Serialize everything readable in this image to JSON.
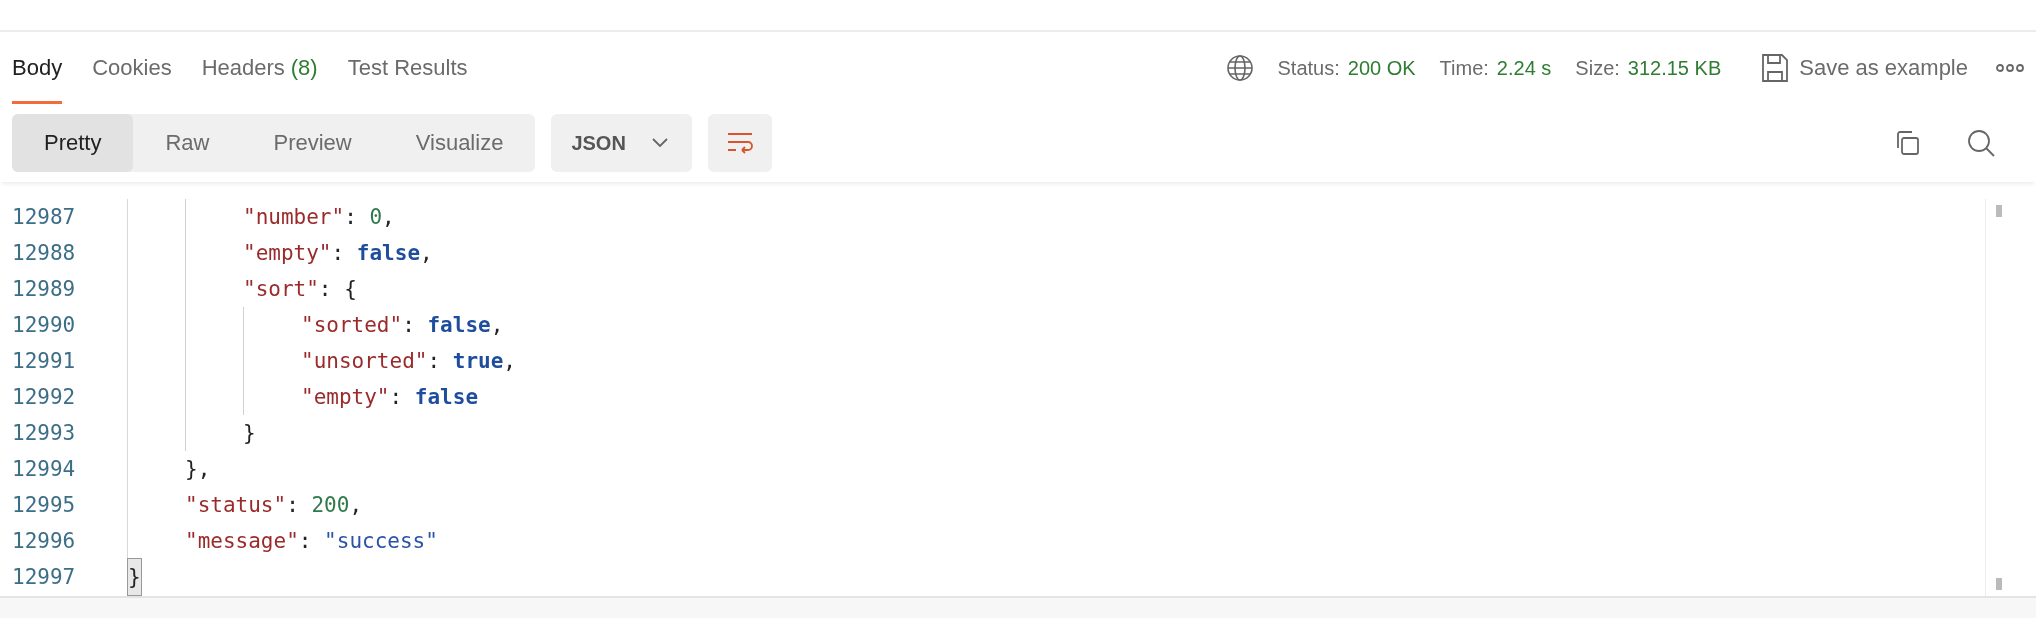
{
  "tabs": [
    {
      "label": "Body",
      "selected": true
    },
    {
      "label": "Cookies",
      "selected": false
    },
    {
      "label": "Headers",
      "count": "(8)",
      "selected": false
    },
    {
      "label": "Test Results",
      "selected": false
    }
  ],
  "response_meta": [
    {
      "label": "Status:",
      "value": "200 OK"
    },
    {
      "label": "Time:",
      "value": "2.24 s"
    },
    {
      "label": "Size:",
      "value": "312.15 KB"
    }
  ],
  "save_button": "Save as example",
  "view_modes": [
    {
      "label": "Pretty",
      "selected": true
    },
    {
      "label": "Raw",
      "selected": false
    },
    {
      "label": "Preview",
      "selected": false
    },
    {
      "label": "Visualize",
      "selected": false
    }
  ],
  "format_dropdown": "JSON",
  "wrap_lines": {
    "on": true
  },
  "code_lines": [
    {
      "children": [
        {
          "children": [
            {
              "number": "12987",
              "tokens": [
                {
                  "kind": "key",
                  "text": "\"number\""
                },
                {
                  "kind": "punct",
                  "text": ": "
                },
                {
                  "kind": "number",
                  "text": "0"
                },
                {
                  "kind": "punct",
                  "text": ","
                }
              ]
            },
            {
              "number": "12988",
              "tokens": [
                {
                  "kind": "key",
                  "text": "\"empty\""
                },
                {
                  "kind": "punct",
                  "text": ": "
                },
                {
                  "kind": "boolean",
                  "text": "false"
                },
                {
                  "kind": "punct",
                  "text": ","
                }
              ]
            },
            {
              "number": "12989",
              "tokens": [
                {
                  "kind": "key",
                  "text": "\"sort\""
                },
                {
                  "kind": "punct",
                  "text": ": {"
                }
              ],
              "children": [
                {
                  "number": "12990",
                  "tokens": [
                    {
                      "kind": "key",
                      "text": "\"sorted\""
                    },
                    {
                      "kind": "punct",
                      "text": ": "
                    },
                    {
                      "kind": "boolean",
                      "text": "false"
                    },
                    {
                      "kind": "punct",
                      "text": ","
                    }
                  ]
                },
                {
                  "number": "12991",
                  "tokens": [
                    {
                      "kind": "key",
                      "text": "\"unsorted\""
                    },
                    {
                      "kind": "punct",
                      "text": ": "
                    },
                    {
                      "kind": "boolean",
                      "text": "true"
                    },
                    {
                      "kind": "punct",
                      "text": ","
                    }
                  ]
                },
                {
                  "number": "12992",
                  "tokens": [
                    {
                      "kind": "key",
                      "text": "\"empty\""
                    },
                    {
                      "kind": "punct",
                      "text": ": "
                    },
                    {
                      "kind": "boolean",
                      "text": "false"
                    }
                  ]
                }
              ]
            },
            {
              "number": "12993",
              "tokens": [
                {
                  "kind": "punct",
                  "text": "}"
                }
              ]
            }
          ]
        },
        {
          "number": "12994",
          "tokens": [
            {
              "kind": "punct",
              "text": "},"
            }
          ]
        },
        {
          "number": "12995",
          "tokens": [
            {
              "kind": "key",
              "text": "\"status\""
            },
            {
              "kind": "punct",
              "text": ": "
            },
            {
              "kind": "number",
              "text": "200"
            },
            {
              "kind": "punct",
              "text": ","
            }
          ]
        },
        {
          "number": "12996",
          "tokens": [
            {
              "kind": "key",
              "text": "\"message\""
            },
            {
              "kind": "punct",
              "text": ": "
            },
            {
              "kind": "string",
              "text": "\"success\""
            }
          ]
        }
      ]
    },
    {
      "number": "12997",
      "tokens": [
        {
          "kind": "punct",
          "text": "}",
          "matched": true
        }
      ]
    }
  ]
}
